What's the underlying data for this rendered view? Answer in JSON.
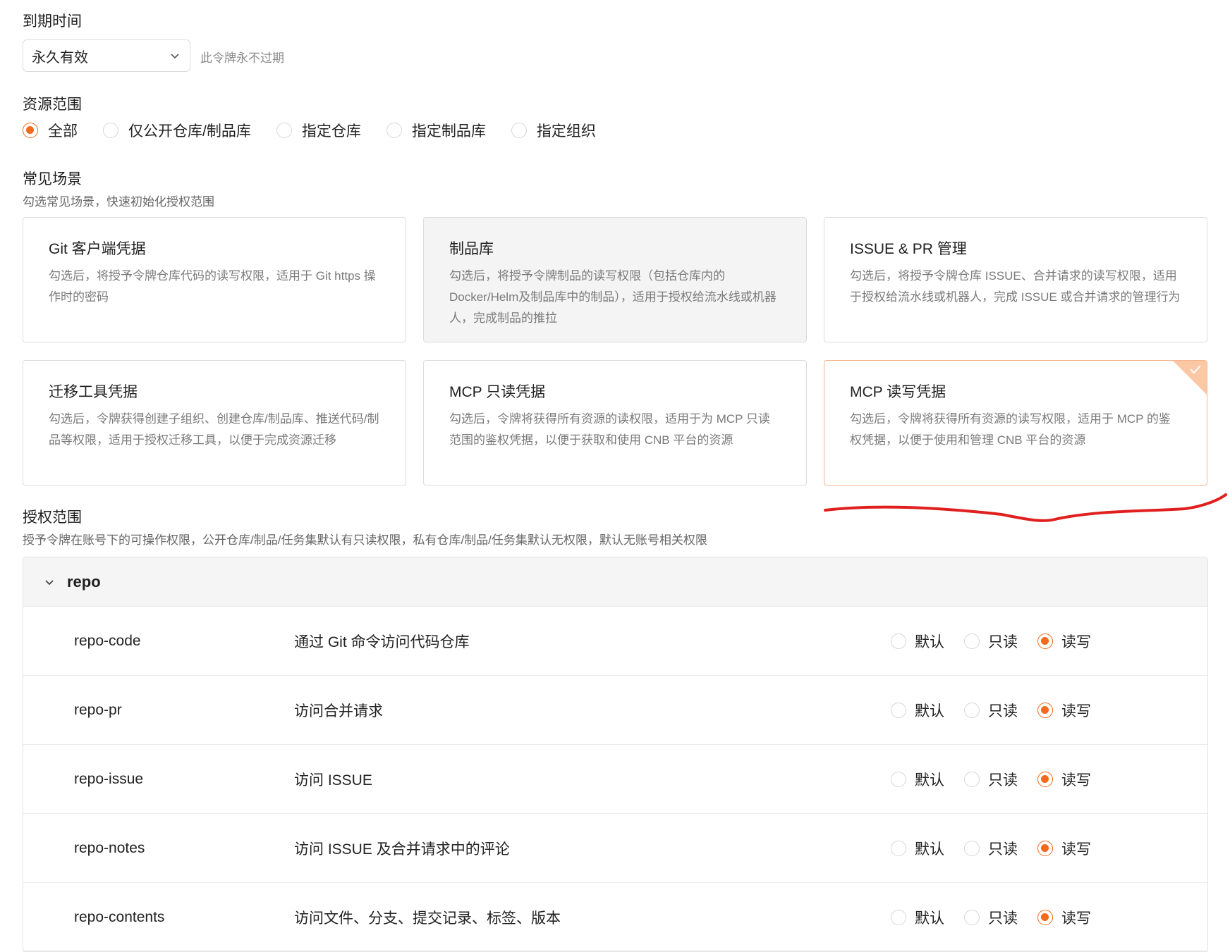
{
  "expiry": {
    "label": "到期时间",
    "value": "永久有效",
    "hint": "此令牌永不过期"
  },
  "resource_scope": {
    "label": "资源范围",
    "options": [
      {
        "label": "全部",
        "checked": true
      },
      {
        "label": "仅公开仓库/制品库",
        "checked": false
      },
      {
        "label": "指定仓库",
        "checked": false
      },
      {
        "label": "指定制品库",
        "checked": false
      },
      {
        "label": "指定组织",
        "checked": false
      }
    ]
  },
  "scenarios": {
    "label": "常见场景",
    "desc": "勾选常见场景，快速初始化授权范围",
    "cards": [
      {
        "title": "Git 客户端凭据",
        "desc": "勾选后，将授予令牌仓库代码的读写权限，适用于 Git https 操作时的密码"
      },
      {
        "title": "制品库",
        "desc": "勾选后，将授予令牌制品的读写权限（包括仓库内的 Docker/Helm及制品库中的制品），适用于授权给流水线或机器人，完成制品的推拉"
      },
      {
        "title": "ISSUE & PR 管理",
        "desc": "勾选后，将授予令牌仓库 ISSUE、合并请求的读写权限，适用于授权给流水线或机器人，完成 ISSUE 或合并请求的管理行为"
      },
      {
        "title": "迁移工具凭据",
        "desc": "勾选后，令牌获得创建子组织、创建仓库/制品库、推送代码/制品等权限，适用于授权迁移工具，以便于完成资源迁移"
      },
      {
        "title": "MCP 只读凭据",
        "desc": "勾选后，令牌将获得所有资源的读权限，适用于为 MCP 只读范围的鉴权凭据，以便于获取和使用 CNB 平台的资源"
      },
      {
        "title": "MCP 读写凭据",
        "desc": "勾选后，令牌将获得所有资源的读写权限，适用于 MCP 的鉴权凭据，以便于使用和管理 CNB 平台的资源"
      }
    ]
  },
  "auth_scope": {
    "label": "授权范围",
    "desc": "授予令牌在账号下的可操作权限，公开仓库/制品/任务集默认有只读权限，私有仓库/制品/任务集默认无权限，默认无账号相关权限",
    "group": "repo",
    "option_labels": {
      "default": "默认",
      "read": "只读",
      "readwrite": "读写"
    },
    "permissions": [
      {
        "name": "repo-code",
        "desc": "通过 Git 命令访问代码仓库",
        "value": "读写"
      },
      {
        "name": "repo-pr",
        "desc": "访问合并请求",
        "value": "读写"
      },
      {
        "name": "repo-issue",
        "desc": "访问 ISSUE",
        "value": "读写"
      },
      {
        "name": "repo-notes",
        "desc": "访问 ISSUE 及合并请求中的评论",
        "value": "读写"
      },
      {
        "name": "repo-contents",
        "desc": "访问文件、分支、提交记录、标签、版本",
        "value": "读写"
      }
    ]
  },
  "colors": {
    "accent": "#f26a1b",
    "annotation": "#e0201e"
  },
  "icons": {
    "select_arrow": "chevron-down-icon",
    "group_toggle": "chevron-down-icon",
    "selected_mark": "check-icon"
  }
}
